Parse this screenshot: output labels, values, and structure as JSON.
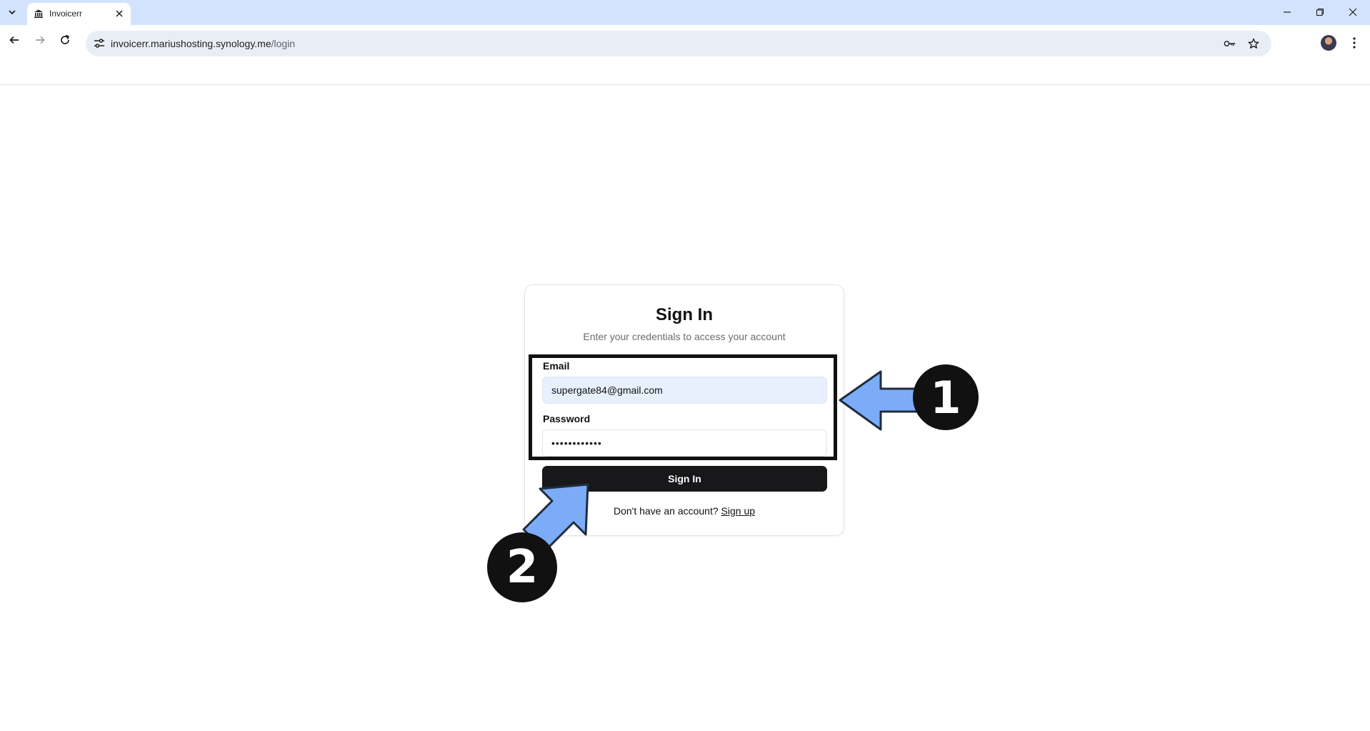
{
  "browser": {
    "tab_title": "Invoicerr",
    "url_host": "invoicerr.mariushosting.synology.me",
    "url_path": "/login"
  },
  "icons": {
    "tab_list": "chevron-down-icon",
    "favicon": "bank-icon",
    "tab_close": "close-icon",
    "minimize": "minimize-icon",
    "restore": "restore-icon",
    "window_close": "close-icon",
    "back": "arrow-left-icon",
    "forward": "arrow-right-icon",
    "reload": "reload-icon",
    "site_info": "tune-icon",
    "password_key": "key-icon",
    "bookmark": "star-icon",
    "menu": "kebab-menu-icon"
  },
  "login": {
    "title": "Sign In",
    "subtitle": "Enter your credentials to access your account",
    "email_label": "Email",
    "email_value": "supergate84@gmail.com",
    "password_label": "Password",
    "password_value": "••••••••••••",
    "submit_label": "Sign In",
    "signup_prompt": "Don't have an account?",
    "signup_link": "Sign up"
  },
  "annotations": {
    "step1": "1",
    "step2": "2",
    "arrow_color": "#7cacf8",
    "outline_color": "#111111"
  }
}
